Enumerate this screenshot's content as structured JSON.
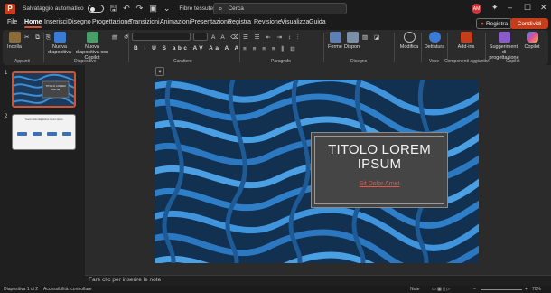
{
  "titlebar": {
    "logo": "P",
    "autosave_label": "Salvataggio automatico",
    "document_title": "Fibre tessute  ·  PowerPoint",
    "search_placeholder": "Cerca",
    "avatar_initials": "AM"
  },
  "tabs": [
    "File",
    "Home",
    "Inserisci",
    "Disegno",
    "Progettazione",
    "Transizioni",
    "Animazioni",
    "Presentazione",
    "Registra",
    "Revisione",
    "Visualizza",
    "Guida"
  ],
  "active_tab": "Home",
  "record_button": "Registra",
  "share_button": "Condividi",
  "ribbon": {
    "paste": "Incolla",
    "new_slide": "Nuova diapositiva",
    "new_slide_copilot": "Nuova diapositiva con Copilot",
    "shapes": "Forme",
    "arrange": "Disponi",
    "edit": "Modifica",
    "dictate": "Dettatura",
    "addins": "Add-ins",
    "suggestions": "Suggerimenti di progettazione",
    "copilot": "Copilot",
    "groups": {
      "clipboard": "Appunti",
      "slides": "Diapositive",
      "font": "Carattere",
      "paragraph": "Paragrafo",
      "drawing": "Disegno",
      "voice": "Voce",
      "addins_group": "Componenti aggiuntivi",
      "copilot_group": "Copilot"
    }
  },
  "slides_pane": {
    "slide_numbers": [
      "1",
      "2"
    ],
    "thumb1_title": "TITOLO LOREM IPSUM",
    "thumb2_heading": "Nuovo titolo diapositiva: Lorem Ipsum"
  },
  "slide": {
    "title": "TITOLO LOREM IPSUM",
    "subtitle": "Sit Dolor Amet"
  },
  "notes_placeholder": "Fare clic per inserire le note",
  "status": {
    "slide_indicator": "Diapositiva 1 di 2",
    "accessibility": "Accessibilità: controllare",
    "notes": "Note",
    "zoom": "70%"
  },
  "colors": {
    "accent": "#c43e1c",
    "tab_underline": "#d35230",
    "slide_background": "#163452",
    "subtitle": "#e05a4c"
  }
}
